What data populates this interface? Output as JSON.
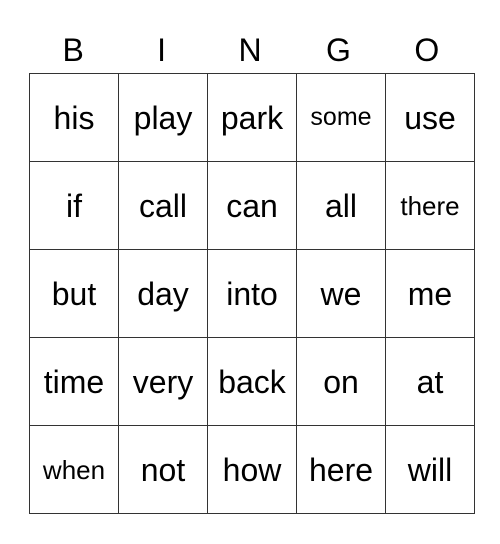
{
  "header": [
    "B",
    "I",
    "N",
    "G",
    "O"
  ],
  "rows": [
    [
      "his",
      "play",
      "park",
      "some",
      "use"
    ],
    [
      "if",
      "call",
      "can",
      "all",
      "there"
    ],
    [
      "but",
      "day",
      "into",
      "we",
      "me"
    ],
    [
      "time",
      "very",
      "back",
      "on",
      "at"
    ],
    [
      "when",
      "not",
      "how",
      "here",
      "will"
    ]
  ]
}
